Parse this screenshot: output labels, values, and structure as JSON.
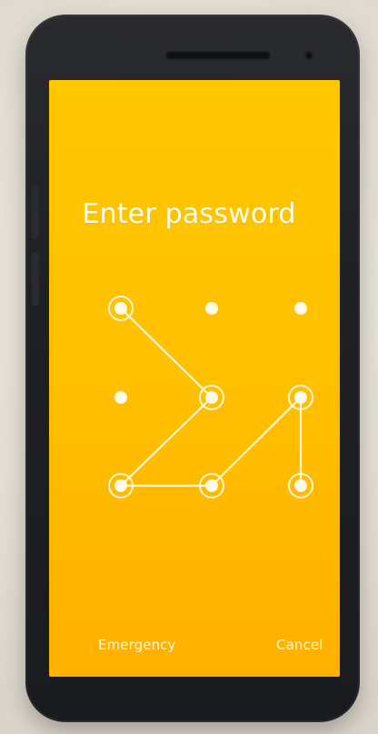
{
  "lock_screen": {
    "title": "Enter password",
    "emergency_label": "Emergency",
    "cancel_label": "Cancel"
  },
  "pattern": {
    "grid": "3x3",
    "active_nodes": [
      {
        "row": 1,
        "col": 1
      },
      {
        "row": 2,
        "col": 2
      },
      {
        "row": 3,
        "col": 1
      },
      {
        "row": 3,
        "col": 2
      },
      {
        "row": 2,
        "col": 3
      },
      {
        "row": 3,
        "col": 3
      }
    ],
    "path_order": [
      {
        "row": 1,
        "col": 1
      },
      {
        "row": 2,
        "col": 2
      },
      {
        "row": 3,
        "col": 1
      },
      {
        "row": 3,
        "col": 2
      },
      {
        "row": 2,
        "col": 3
      },
      {
        "row": 3,
        "col": 3
      }
    ]
  },
  "colors": {
    "screen_top": "#ffc700",
    "screen_bottom": "#ffb000",
    "device_body": "#1f2023",
    "background": "#e6e1d8",
    "text": "#fffdf2"
  }
}
